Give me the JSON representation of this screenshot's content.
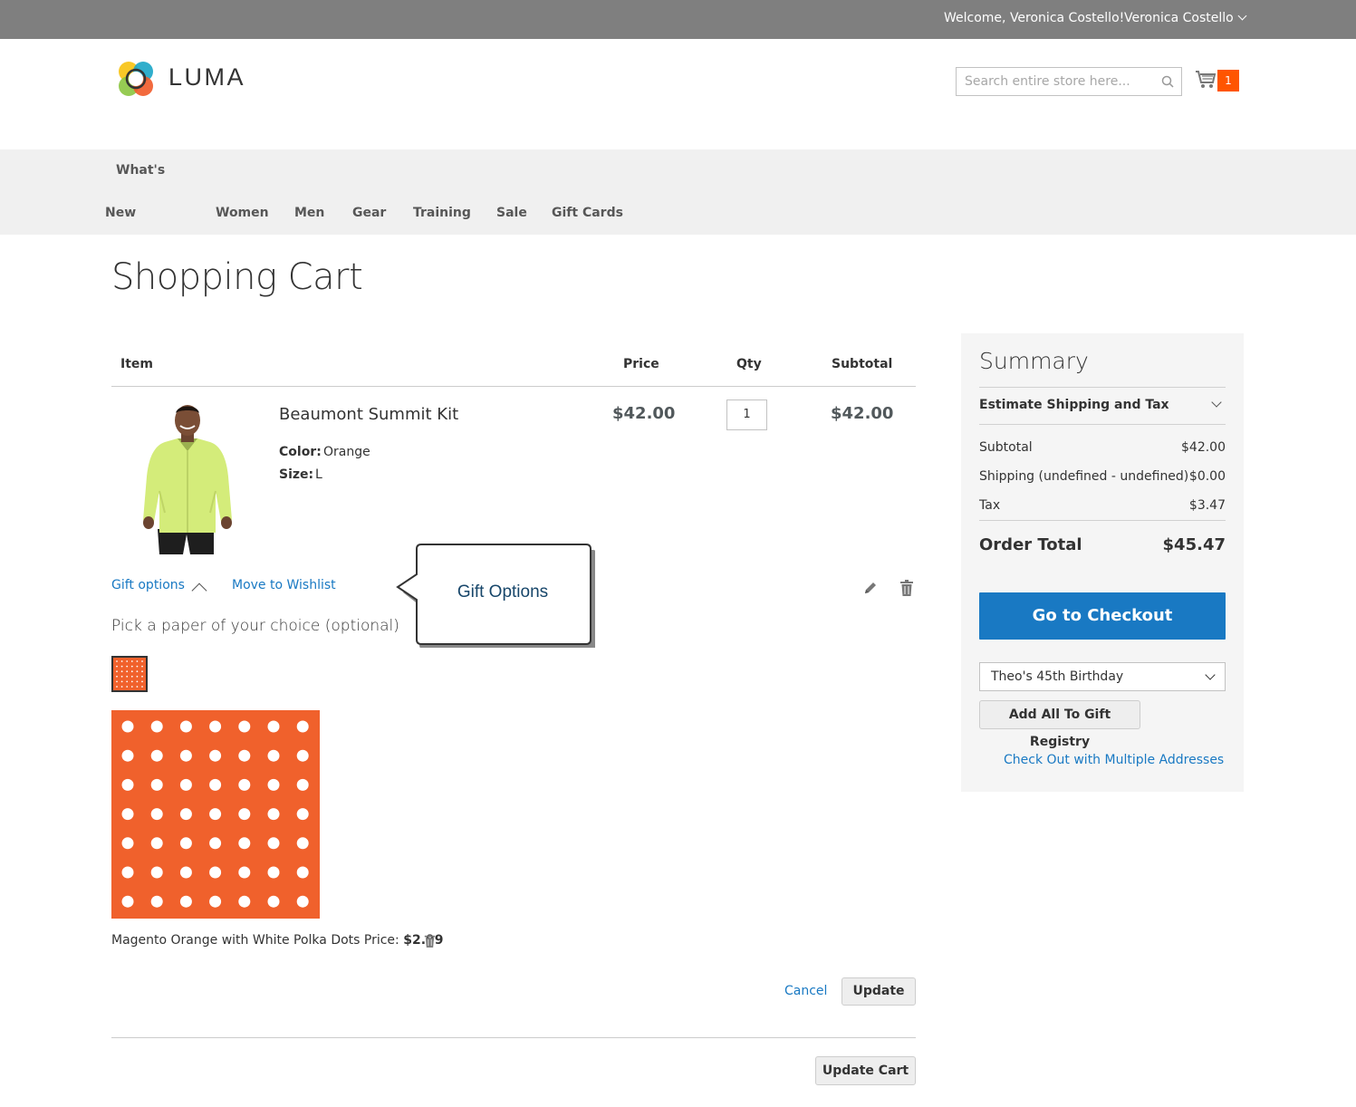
{
  "header": {
    "welcome": "Welcome, Veronica Costello!",
    "account_name": "Veronica Costello",
    "logo_text": "LUMA",
    "search_placeholder": "Search entire store here...",
    "cart_count": "1"
  },
  "nav": {
    "items": [
      "What's",
      "New",
      "Women",
      "Men",
      "Gear",
      "Training",
      "Sale",
      "Gift Cards"
    ]
  },
  "page": {
    "title": "Shopping Cart"
  },
  "cart": {
    "columns": [
      "Item",
      "Price",
      "Qty",
      "Subtotal"
    ],
    "item": {
      "name": "Beaumont Summit Kit",
      "color_label": "Color:",
      "color_value": "Orange",
      "size_label": "Size:",
      "size_value": "L",
      "price": "$42.00",
      "qty": "1",
      "subtotal": "$42.00"
    },
    "gift_options_link": "Gift options",
    "move_to_wishlist": "Move to Wishlist",
    "callout": "Gift Options",
    "pick_paper": "Pick a paper of your choice (optional)",
    "paper_name": "Magento Orange with White Polka Dots Price:",
    "paper_price": "$2.99",
    "paper_color": "#f0612c",
    "cancel": "Cancel",
    "update": "Update",
    "update_cart": "Update Cart"
  },
  "summary": {
    "title": "Summary",
    "estimate": "Estimate Shipping and Tax",
    "rows": [
      {
        "label": "Subtotal",
        "value": "$42.00"
      },
      {
        "label": "Shipping (undefined - undefined)",
        "value": "$0.00"
      },
      {
        "label": "Tax",
        "value": "$3.47"
      }
    ],
    "order_total_label": "Order Total",
    "order_total_value": "$45.47",
    "checkout": "Go to Checkout",
    "registry_selected": "Theo's 45th Birthday",
    "add_registry": "Add All To Gift Registry",
    "multi_address": "Check Out with Multiple Addresses"
  },
  "colors": {
    "accent": "#1979c3",
    "cart_badge": "#ff5501",
    "top_bar": "#7f7f7f"
  }
}
